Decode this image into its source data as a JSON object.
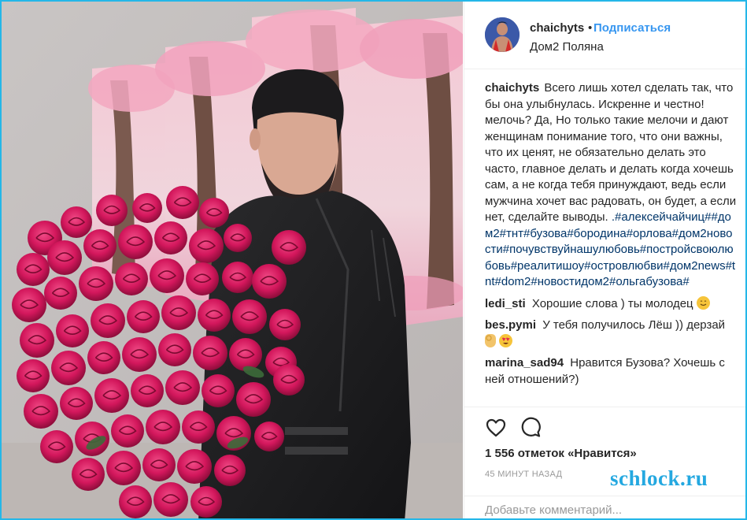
{
  "post": {
    "username": "chaichyts",
    "separator": "•",
    "follow_label": "Подписаться",
    "location": "Дом2 Поляна",
    "caption_user": "chaichyts",
    "caption_text": "Всего лишь хотел сделать так, что бы она улыбнулась. Искренне и честно! мелочь? Да, Но только такие мелочи и дают женщинам понимание того, что они важны, что их ценят, не обязательно делать это часто, главное делать и делать когда хочешь сам, а не когда тебя принуждают, ведь если мужчина хочет вас радовать, он будет, а если нет, сделайте выводы.",
    "caption_tags": ".#алексейчайчиц##дом2#тнт#бузова#бородина#орлова#дом2новости#почувствуйнашулюбовь#постройсвоюлюбовь#реалитишоу#островлюбви#дом2news#tnt#dom2#новостидом2#ольгабузова#",
    "likes": "1 556 отметок «Нравится»",
    "time": "45 МИНУТ НАЗАД",
    "comment_placeholder": "Добавьте комментарий...",
    "like_icon": "heart-outline-icon",
    "comment_icon": "speech-bubble-icon"
  },
  "comments": [
    {
      "user": "ledi_sti",
      "text": "Хорошие слова ) ты молодец",
      "emoji": "smiling-face"
    },
    {
      "user": "bes.pymi",
      "text": "У тебя получилось Лёш )) дерзай",
      "emoji": "ok-hand,heart-eyes"
    },
    {
      "user": "marina_sad94",
      "text": "Нравится Бузова? Хочешь с ней отношений?)"
    }
  ],
  "watermark": "schlock.ru",
  "colors": {
    "link": "#3897f0",
    "hashtag": "#003569",
    "frame": "#24b7e8",
    "watermark": "#24a8e0",
    "roses": "#d81b60"
  }
}
